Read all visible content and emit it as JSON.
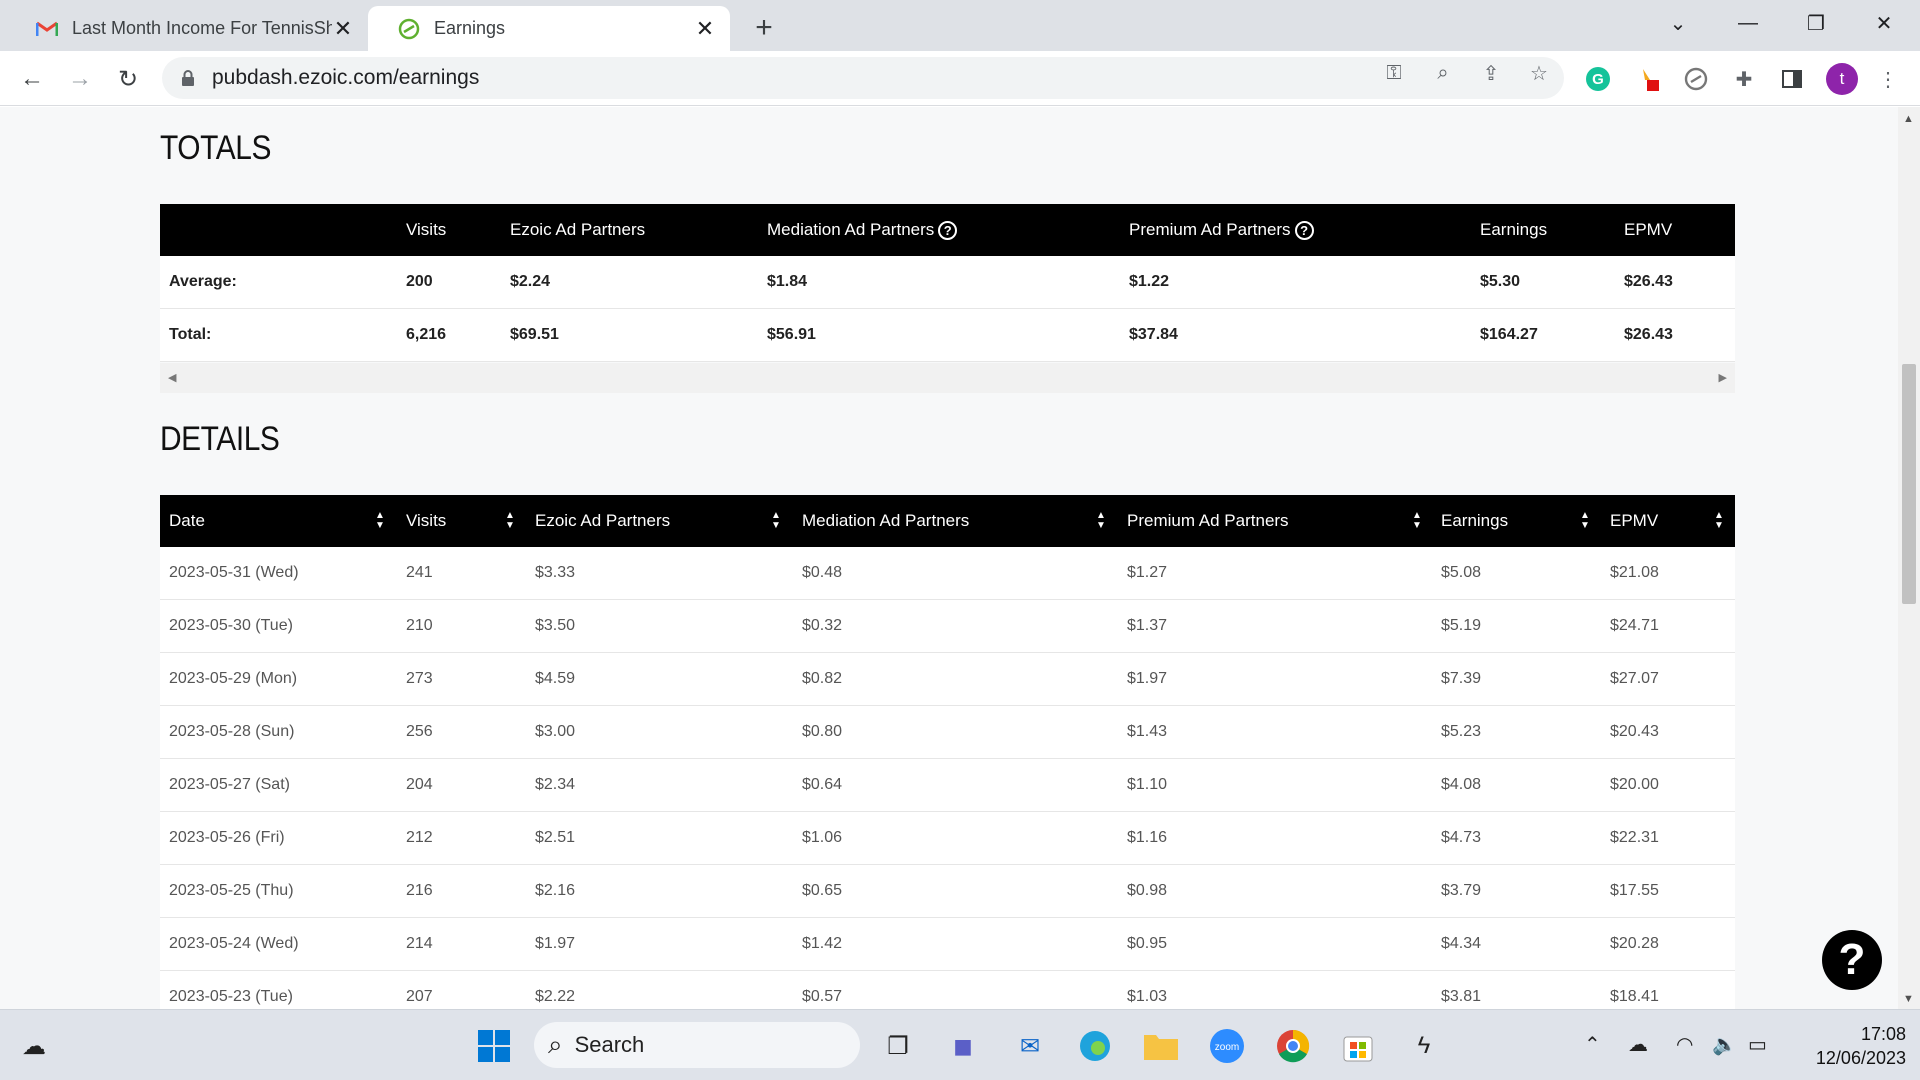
{
  "browser": {
    "tabs": [
      {
        "title": "Last Month Income For TennisSh",
        "favicon": "gmail-icon"
      },
      {
        "title": "Earnings",
        "favicon": "ezoic-icon"
      }
    ],
    "url": "pubdash.ezoic.com/earnings",
    "profile_initial": "t"
  },
  "totals": {
    "title": "TOTALS",
    "columns": [
      "",
      "Visits",
      "Ezoic Ad Partners",
      "Mediation Ad Partners",
      "Premium Ad Partners",
      "Earnings",
      "EPMV"
    ],
    "rows": [
      [
        "Average:",
        "200",
        "$2.24",
        "$1.84",
        "$1.22",
        "$5.30",
        "$26.43"
      ],
      [
        "Total:",
        "6,216",
        "$69.51",
        "$56.91",
        "$37.84",
        "$164.27",
        "$26.43"
      ]
    ]
  },
  "details": {
    "title": "DETAILS",
    "columns": [
      "Date",
      "Visits",
      "Ezoic Ad Partners",
      "Mediation Ad Partners",
      "Premium Ad Partners",
      "Earnings",
      "EPMV"
    ],
    "rows": [
      [
        "2023-05-31 (Wed)",
        "241",
        "$3.33",
        "$0.48",
        "$1.27",
        "$5.08",
        "$21.08"
      ],
      [
        "2023-05-30 (Tue)",
        "210",
        "$3.50",
        "$0.32",
        "$1.37",
        "$5.19",
        "$24.71"
      ],
      [
        "2023-05-29 (Mon)",
        "273",
        "$4.59",
        "$0.82",
        "$1.97",
        "$7.39",
        "$27.07"
      ],
      [
        "2023-05-28 (Sun)",
        "256",
        "$3.00",
        "$0.80",
        "$1.43",
        "$5.23",
        "$20.43"
      ],
      [
        "2023-05-27 (Sat)",
        "204",
        "$2.34",
        "$0.64",
        "$1.10",
        "$4.08",
        "$20.00"
      ],
      [
        "2023-05-26 (Fri)",
        "212",
        "$2.51",
        "$1.06",
        "$1.16",
        "$4.73",
        "$22.31"
      ],
      [
        "2023-05-25 (Thu)",
        "216",
        "$2.16",
        "$0.65",
        "$0.98",
        "$3.79",
        "$17.55"
      ],
      [
        "2023-05-24 (Wed)",
        "214",
        "$1.97",
        "$1.42",
        "$0.95",
        "$4.34",
        "$20.28"
      ],
      [
        "2023-05-23 (Tue)",
        "207",
        "$2.22",
        "$0.57",
        "$1.03",
        "$3.81",
        "$18.41"
      ]
    ]
  },
  "help_label": "?",
  "taskbar": {
    "search_label": "Search",
    "time": "17:08",
    "date": "12/06/2023"
  }
}
